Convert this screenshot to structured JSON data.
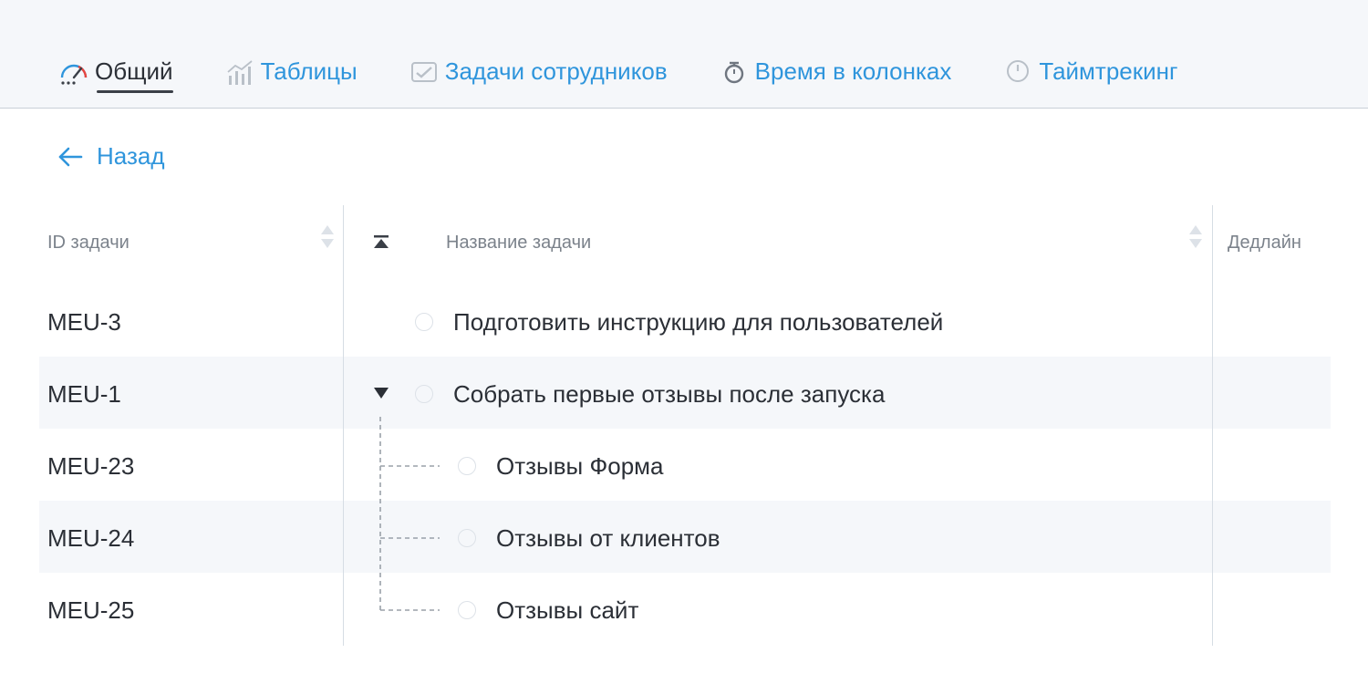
{
  "tabs": [
    {
      "label": "Общий",
      "icon": "speedometer-icon",
      "active": true
    },
    {
      "label": "Таблицы",
      "icon": "bar-chart-icon",
      "active": false
    },
    {
      "label": "Задачи сотрудников",
      "icon": "checklist-icon",
      "active": false
    },
    {
      "label": "Время в колонках",
      "icon": "stopwatch-icon",
      "active": false
    },
    {
      "label": "Таймтрекинг",
      "icon": "clock-icon",
      "active": false
    }
  ],
  "back": {
    "label": "Назад",
    "icon": "arrow-left-icon"
  },
  "table": {
    "headers": {
      "id": "ID задачи",
      "name": "Название задачи",
      "deadline": "Дедлайн"
    },
    "rows": [
      {
        "id": "MEU-3",
        "name": "Подготовить инструкцию для пользователей",
        "level": 0,
        "expandable": false
      },
      {
        "id": "MEU-1",
        "name": "Собрать первые отзывы после запуска",
        "level": 0,
        "expandable": true
      },
      {
        "id": "MEU-23",
        "name": "Отзывы Форма",
        "level": 1,
        "expandable": false
      },
      {
        "id": "MEU-24",
        "name": "Отзывы от клиентов",
        "level": 1,
        "expandable": false
      },
      {
        "id": "MEU-25",
        "name": "Отзывы сайт",
        "level": 1,
        "expandable": false
      }
    ]
  },
  "colors": {
    "accent": "#2f95dc",
    "text": "#2b2f36",
    "header_bg": "#f5f7fa",
    "row_alt_bg": "#f5f7fa"
  }
}
